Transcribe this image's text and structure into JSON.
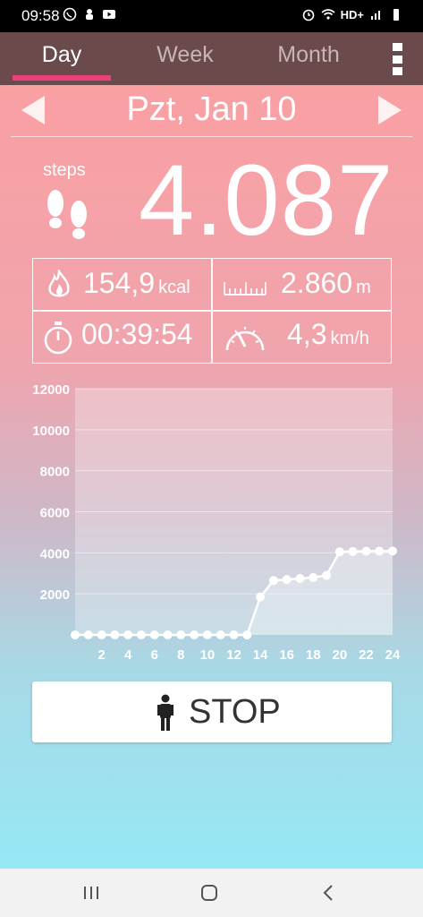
{
  "status_bar": {
    "time": "09:58",
    "network": "HD+",
    "left_icons": [
      "whatsapp-icon",
      "notification-icon",
      "youtube-icon"
    ],
    "right_icons": [
      "alarm-icon",
      "wifi-icon",
      "signal-icon",
      "battery-icon"
    ]
  },
  "tabs": [
    {
      "label": "Day",
      "active": true
    },
    {
      "label": "Week",
      "active": false
    },
    {
      "label": "Month",
      "active": false
    }
  ],
  "date": "Pzt, Jan 10",
  "steps": {
    "label": "steps",
    "value": "4.087"
  },
  "stats": {
    "calories": {
      "value": "154,9",
      "unit": "kcal"
    },
    "distance": {
      "value": "2.860",
      "unit": "m"
    },
    "duration": {
      "value": "00:39:54"
    },
    "speed": {
      "value": "4,3",
      "unit": "km/h"
    }
  },
  "colors": {
    "accent": "#ec407a",
    "tabbar": "#6a4a4a"
  },
  "chart_data": {
    "type": "area",
    "x": [
      0,
      1,
      2,
      3,
      4,
      5,
      6,
      7,
      8,
      9,
      10,
      11,
      12,
      13,
      14,
      15,
      16,
      17,
      18,
      19,
      20,
      21,
      22,
      23,
      24
    ],
    "values": [
      0,
      0,
      0,
      0,
      0,
      0,
      0,
      0,
      0,
      0,
      0,
      0,
      0,
      0,
      1850,
      2650,
      2700,
      2750,
      2800,
      2900,
      4050,
      4070,
      4080,
      4085,
      4087
    ],
    "xticks": [
      2,
      4,
      6,
      8,
      10,
      12,
      14,
      16,
      18,
      20,
      22,
      24
    ],
    "yticks": [
      2000,
      4000,
      6000,
      8000,
      10000,
      12000
    ],
    "ylim": [
      0,
      12000
    ],
    "xlim": [
      0,
      24
    ],
    "grid": true
  },
  "stop_button": {
    "label": "STOP"
  }
}
